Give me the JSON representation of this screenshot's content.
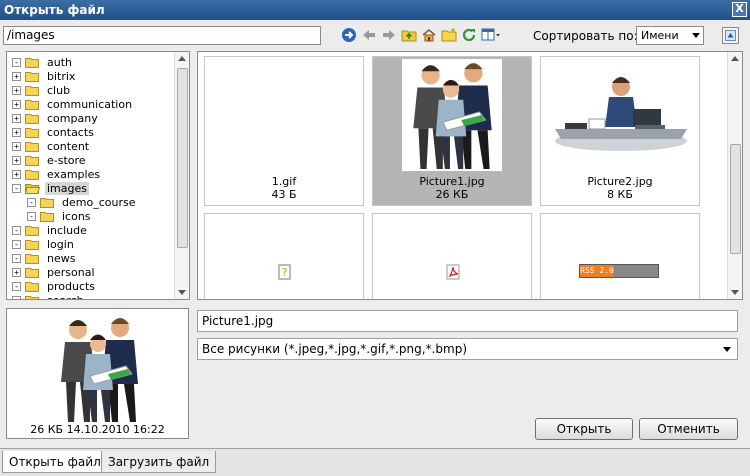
{
  "window": {
    "title": "Открыть файл",
    "close_label": "X"
  },
  "path": {
    "value": "/images"
  },
  "toolbar": {
    "icons": [
      "go-icon",
      "back-icon",
      "forward-icon",
      "up-folder-icon",
      "home-icon",
      "new-folder-icon",
      "refresh-icon",
      "view-mode-icon"
    ]
  },
  "sort": {
    "label": "Сортировать по:",
    "value": "Имени"
  },
  "tree": {
    "items": [
      {
        "label": "auth",
        "expander": "-",
        "level": 0
      },
      {
        "label": "bitrix",
        "expander": "+",
        "level": 0
      },
      {
        "label": "club",
        "expander": "+",
        "level": 0
      },
      {
        "label": "communication",
        "expander": "+",
        "level": 0
      },
      {
        "label": "company",
        "expander": "+",
        "level": 0
      },
      {
        "label": "contacts",
        "expander": "+",
        "level": 0
      },
      {
        "label": "content",
        "expander": "+",
        "level": 0
      },
      {
        "label": "e-store",
        "expander": "+",
        "level": 0
      },
      {
        "label": "examples",
        "expander": "+",
        "level": 0
      },
      {
        "label": "images",
        "expander": "-",
        "level": 0,
        "selected": true
      },
      {
        "label": "demo_course",
        "expander": "-",
        "level": 1
      },
      {
        "label": "icons",
        "expander": "-",
        "level": 1
      },
      {
        "label": "include",
        "expander": "-",
        "level": 0
      },
      {
        "label": "login",
        "expander": "-",
        "level": 0
      },
      {
        "label": "news",
        "expander": "-",
        "level": 0
      },
      {
        "label": "personal",
        "expander": "+",
        "level": 0
      },
      {
        "label": "products",
        "expander": "-",
        "level": 0
      },
      {
        "label": "search",
        "expander": "-",
        "level": 0
      }
    ]
  },
  "files": [
    {
      "name": "1.gif",
      "size": "43 Б",
      "thumb": "blank"
    },
    {
      "name": "Picture1.jpg",
      "size": "26 КБ",
      "thumb": "people",
      "selected": true
    },
    {
      "name": "Picture2.jpg",
      "size": "8 КБ",
      "thumb": "laptop"
    },
    {
      "name": "",
      "size": "",
      "thumb": "unknown-file-icon"
    },
    {
      "name": "",
      "size": "",
      "thumb": "pdf-file-icon"
    },
    {
      "name": "",
      "size": "",
      "thumb": "rss-badge",
      "badge_text": "RSS 2.0"
    }
  ],
  "preview": {
    "meta": "26 КБ 14.10.2010 16:22"
  },
  "filename": {
    "value": "Picture1.jpg"
  },
  "filetype": {
    "value": "Все рисунки (*.jpeg,*.jpg,*.gif,*.png,*.bmp)"
  },
  "buttons": {
    "open": "Открыть",
    "cancel": "Отменить"
  },
  "tabs": [
    {
      "label": "Открыть файл",
      "active": true
    },
    {
      "label": "Загрузить файл",
      "active": false
    }
  ]
}
